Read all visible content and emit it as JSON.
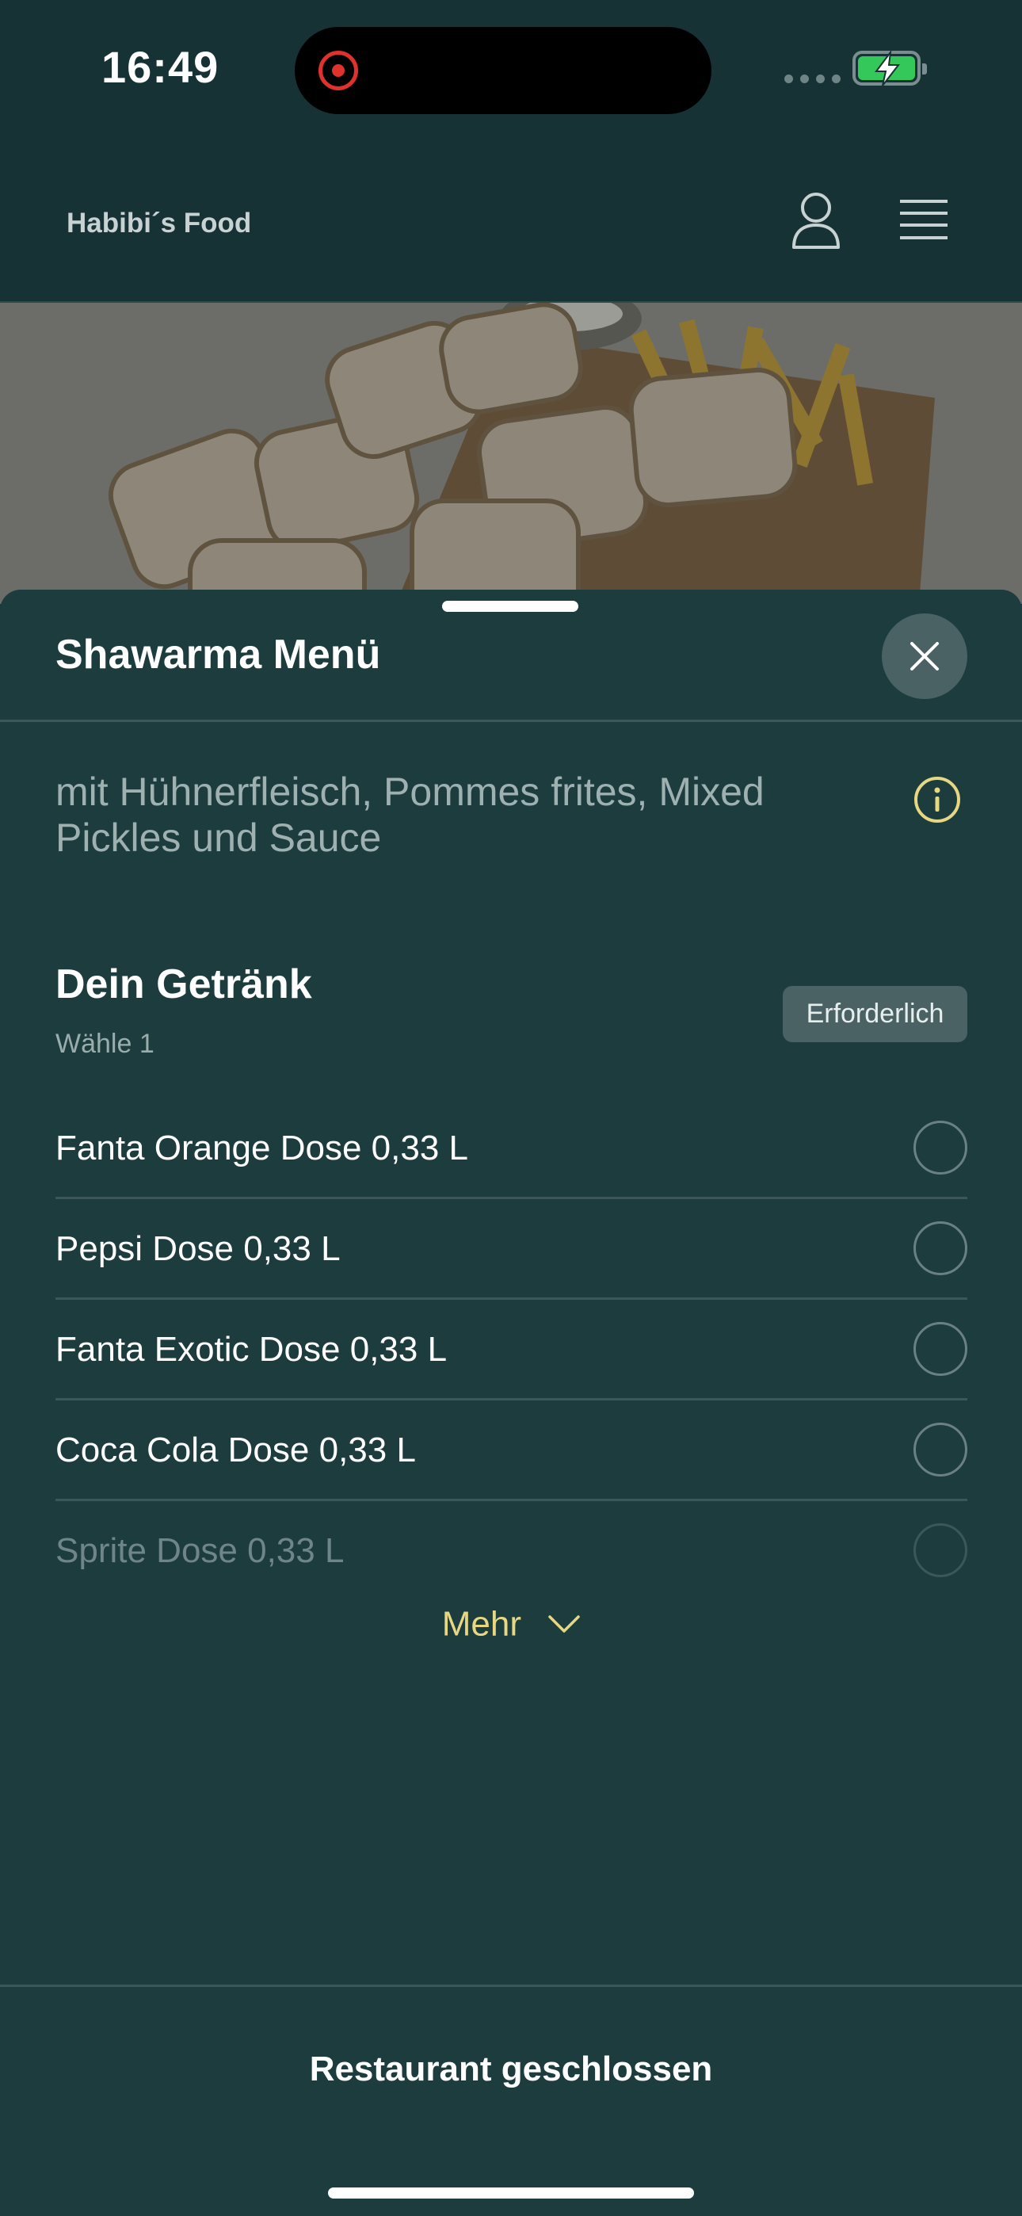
{
  "status_bar": {
    "time": "16:49"
  },
  "header": {
    "brand": "Habibi´s Food",
    "icons": [
      "user-icon",
      "menu-icon"
    ]
  },
  "sheet": {
    "title": "Shawarma Menü",
    "description": "mit Hühnerfleisch, Pommes frites, Mixed Pickles und Sauce",
    "section": {
      "title": "Dein Getränk",
      "subtitle": "Wähle 1",
      "badge": "Erforderlich",
      "options": [
        {
          "label": "Fanta Orange Dose 0,33 L"
        },
        {
          "label": "Pepsi Dose 0,33 L"
        },
        {
          "label": "Fanta Exotic Dose 0,33 L"
        },
        {
          "label": "Coca Cola Dose 0,33 L"
        },
        {
          "label": "Sprite Dose 0,33 L"
        }
      ],
      "more_label": "Mehr"
    },
    "footer_text": "Restaurant geschlossen"
  },
  "colors": {
    "background": "#1c3c3e",
    "header": "#163235",
    "accent": "#e6d783",
    "badge": "#4a6264"
  }
}
